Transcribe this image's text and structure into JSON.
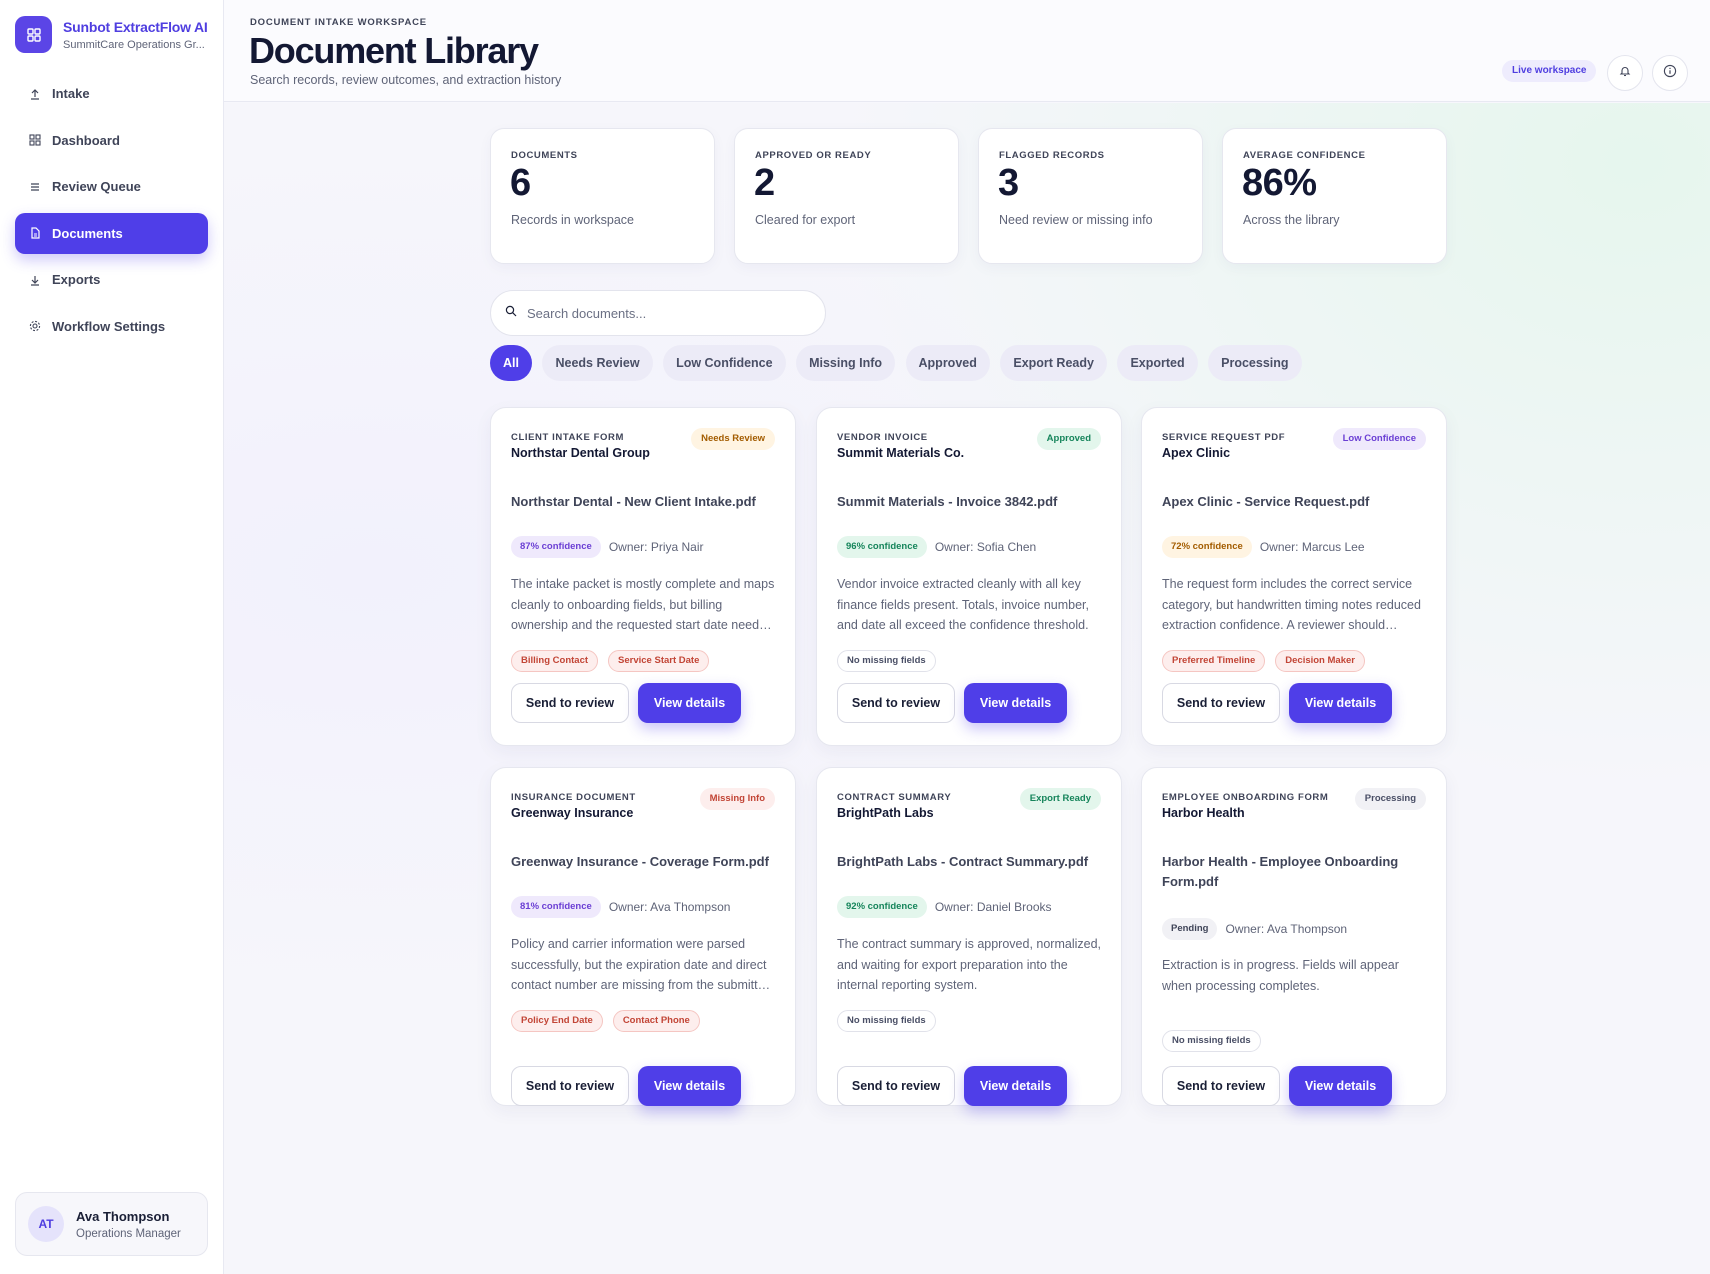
{
  "app": {
    "brand_name": "Sunbot ExtractFlow AI",
    "brand_sub": "SummitCare Operations Gr..."
  },
  "nav": [
    {
      "label": "Intake",
      "icon": "upload-icon"
    },
    {
      "label": "Dashboard",
      "icon": "grid-icon"
    },
    {
      "label": "Review Queue",
      "icon": "list-icon"
    },
    {
      "label": "Documents",
      "icon": "document-icon",
      "active": true
    },
    {
      "label": "Exports",
      "icon": "download-icon"
    },
    {
      "label": "Workflow Settings",
      "icon": "gear-icon"
    }
  ],
  "user": {
    "initials": "AT",
    "name": "Ava Thompson",
    "role": "Operations Manager"
  },
  "header": {
    "eyebrow": "DOCUMENT INTAKE WORKSPACE",
    "title": "Document Library",
    "subtitle": "Search records, review outcomes, and extraction history",
    "live_badge": "Live workspace"
  },
  "stats": [
    {
      "label": "DOCUMENTS",
      "value": "6",
      "desc": "Records in workspace"
    },
    {
      "label": "APPROVED OR READY",
      "value": "2",
      "desc": "Cleared for export"
    },
    {
      "label": "FLAGGED RECORDS",
      "value": "3",
      "desc": "Need review or missing info"
    },
    {
      "label": "AVERAGE CONFIDENCE",
      "value": "86%",
      "desc": "Across the library"
    }
  ],
  "search": {
    "placeholder": "Search documents..."
  },
  "filters": [
    "All",
    "Needs Review",
    "Low Confidence",
    "Missing Info",
    "Approved",
    "Export Ready",
    "Exported",
    "Processing"
  ],
  "colors": {
    "accent": "#4f3ee8",
    "confidence_purple": "#6b3fd4",
    "confidence_green": "#16855b",
    "confidence_amber": "#a35c00"
  },
  "cards": [
    {
      "type": "CLIENT INTAKE FORM",
      "org": "Northstar Dental Group",
      "status": "Needs Review",
      "file": "Northstar Dental - New Client Intake.pdf",
      "confidence": "87% confidence",
      "owner": "Owner: Priya Nair",
      "summary": "The intake packet is mostly complete and maps cleanly to onboarding fields, but billing ownership and the requested start date need confirmation before export.",
      "tags": [
        "Billing Contact",
        "Service Start Date"
      ],
      "review_label": "Send to review",
      "details_label": "View details"
    },
    {
      "type": "VENDOR INVOICE",
      "org": "Summit Materials Co.",
      "status": "Approved",
      "file": "Summit Materials - Invoice 3842.pdf",
      "confidence": "96% confidence",
      "owner": "Owner: Sofia Chen",
      "summary": "Vendor invoice extracted cleanly with all key finance fields present. Totals, invoice number, and date all exceed the confidence threshold.",
      "tags": [
        "No missing fields"
      ],
      "review_label": "Send to review",
      "details_label": "View details"
    },
    {
      "type": "SERVICE REQUEST PDF",
      "org": "Apex Clinic",
      "status": "Low Confidence",
      "file": "Apex Clinic - Service Request.pdf",
      "confidence": "72% confidence",
      "owner": "Owner: Marcus Lee",
      "summary": "The request form includes the correct service category, but handwritten timing notes reduced extraction confidence. A reviewer should confirm the details.",
      "tags": [
        "Preferred Timeline",
        "Decision Maker"
      ],
      "review_label": "Send to review",
      "details_label": "View details"
    },
    {
      "type": "INSURANCE DOCUMENT",
      "org": "Greenway Insurance",
      "status": "Missing Info",
      "file": "Greenway Insurance - Coverage Form.pdf",
      "confidence": "81% confidence",
      "owner": "Owner: Ava Thompson",
      "summary": "Policy and carrier information were parsed successfully, but the expiration date and direct contact number are missing from the submitted form.",
      "tags": [
        "Policy End Date",
        "Contact Phone"
      ],
      "review_label": "Send to review",
      "details_label": "View details"
    },
    {
      "type": "CONTRACT SUMMARY",
      "org": "BrightPath Labs",
      "status": "Export Ready",
      "file": "BrightPath Labs - Contract Summary.pdf",
      "confidence": "92% confidence",
      "owner": "Owner: Daniel Brooks",
      "summary": "The contract summary is approved, normalized, and waiting for export preparation into the internal reporting system.",
      "tags": [
        "No missing fields"
      ],
      "review_label": "Send to review",
      "details_label": "View details"
    },
    {
      "type": "EMPLOYEE ONBOARDING FORM",
      "org": "Harbor Health",
      "status": "Processing",
      "file": "Harbor Health - Employee Onboarding Form.pdf",
      "confidence": "Pending",
      "owner": "Owner: Ava Thompson",
      "summary": "Extraction is in progress. Fields will appear when processing completes.",
      "tags": [
        "No missing fields"
      ],
      "review_label": "Send to review",
      "details_label": "View details"
    }
  ]
}
